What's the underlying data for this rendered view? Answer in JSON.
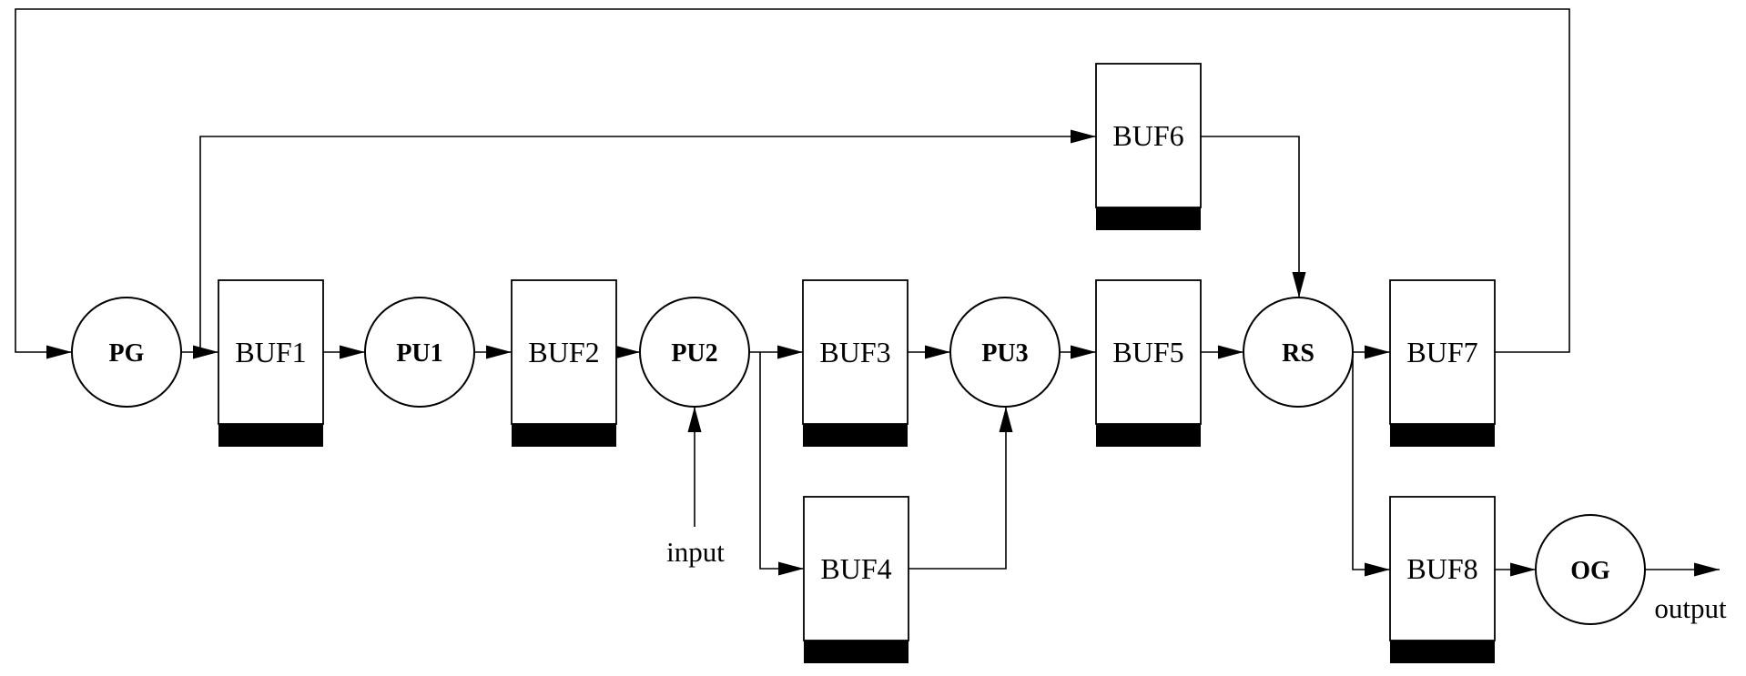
{
  "diagram": {
    "type": "block-diagram",
    "colors": {
      "stroke": "#000000",
      "background": "#ffffff",
      "buffer_bar": "#000000"
    },
    "nodes": {
      "pg": {
        "label": "PG",
        "kind": "process"
      },
      "pu1": {
        "label": "PU1",
        "kind": "process"
      },
      "pu2": {
        "label": "PU2",
        "kind": "process"
      },
      "pu3": {
        "label": "PU3",
        "kind": "process"
      },
      "rs": {
        "label": "RS",
        "kind": "process"
      },
      "og": {
        "label": "OG",
        "kind": "process"
      },
      "buf1": {
        "label": "BUF1",
        "kind": "buffer"
      },
      "buf2": {
        "label": "BUF2",
        "kind": "buffer"
      },
      "buf3": {
        "label": "BUF3",
        "kind": "buffer"
      },
      "buf4": {
        "label": "BUF4",
        "kind": "buffer"
      },
      "buf5": {
        "label": "BUF5",
        "kind": "buffer"
      },
      "buf6": {
        "label": "BUF6",
        "kind": "buffer"
      },
      "buf7": {
        "label": "BUF7",
        "kind": "buffer"
      },
      "buf8": {
        "label": "BUF8",
        "kind": "buffer"
      }
    },
    "io_labels": {
      "input": "input",
      "output": "output"
    },
    "edges": [
      {
        "from": "buf7",
        "to": "pg",
        "note": "feedback loop"
      },
      {
        "from": "pg",
        "to": "buf1"
      },
      {
        "from": "pg",
        "to": "buf6"
      },
      {
        "from": "buf1",
        "to": "pu1"
      },
      {
        "from": "pu1",
        "to": "buf2"
      },
      {
        "from": "buf2",
        "to": "pu2"
      },
      {
        "from": "input",
        "to": "pu2"
      },
      {
        "from": "pu2",
        "to": "buf3"
      },
      {
        "from": "pu2",
        "to": "buf4"
      },
      {
        "from": "buf3",
        "to": "pu3"
      },
      {
        "from": "buf4",
        "to": "pu3"
      },
      {
        "from": "pu3",
        "to": "buf5"
      },
      {
        "from": "buf5",
        "to": "rs"
      },
      {
        "from": "buf6",
        "to": "rs"
      },
      {
        "from": "rs",
        "to": "buf7"
      },
      {
        "from": "rs",
        "to": "buf8"
      },
      {
        "from": "buf8",
        "to": "og"
      },
      {
        "from": "og",
        "to": "output"
      }
    ]
  }
}
